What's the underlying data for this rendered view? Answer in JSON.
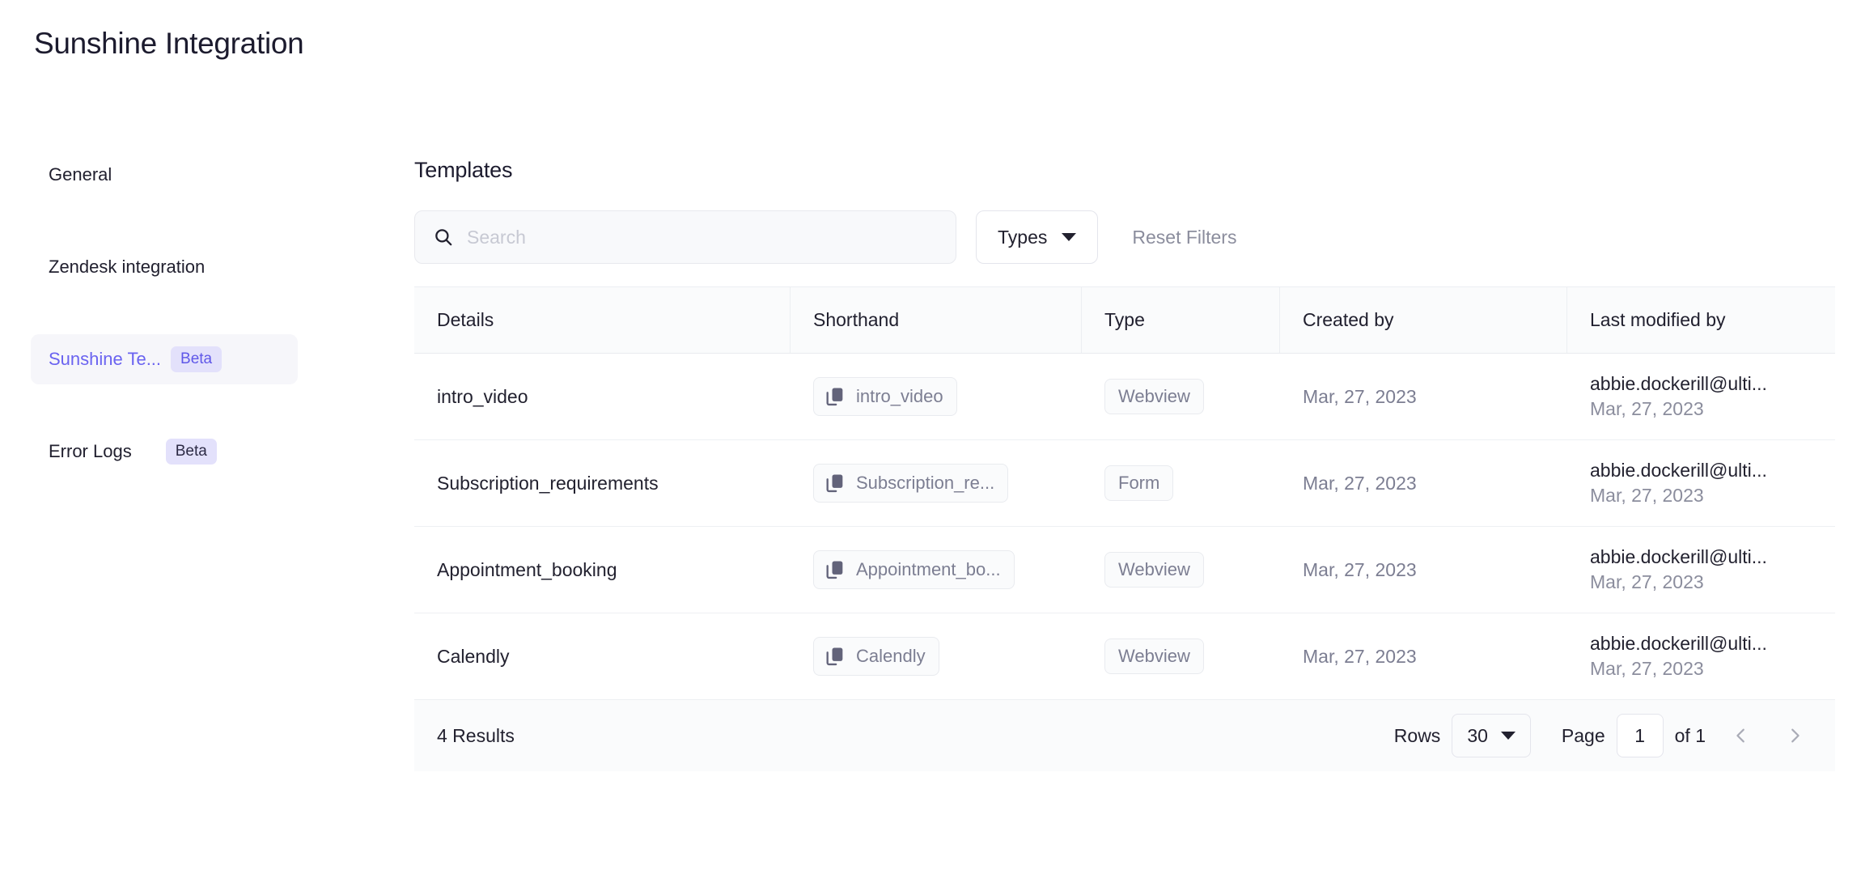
{
  "header": {
    "title": "Sunshine Integration"
  },
  "sidebar": {
    "items": [
      {
        "label": "General",
        "badge": null,
        "active": false
      },
      {
        "label": "Zendesk integration",
        "badge": null,
        "active": false
      },
      {
        "label": "Sunshine Te...",
        "badge": "Beta",
        "active": true
      },
      {
        "label": "Error Logs",
        "badge": "Beta",
        "active": false
      }
    ]
  },
  "main": {
    "section_title": "Templates",
    "filters": {
      "search_placeholder": "Search",
      "search_value": "",
      "search_icon": "search-icon",
      "types_label": "Types",
      "types_caret_icon": "chevron-down-icon",
      "reset_label": "Reset Filters"
    },
    "table": {
      "columns": [
        "Details",
        "Shorthand",
        "Type",
        "Created by",
        "Last modified by"
      ],
      "rows": [
        {
          "details": "intro_video",
          "shorthand": "intro_video",
          "shorthand_icon": "copy-icon",
          "type": "Webview",
          "created_by": "Mar, 27, 2023",
          "modified_email": "abbie.dockerill@ulti...",
          "modified_date": "Mar, 27, 2023"
        },
        {
          "details": "Subscription_requirements",
          "shorthand": "Subscription_re...",
          "shorthand_icon": "copy-icon",
          "type": "Form",
          "created_by": "Mar, 27, 2023",
          "modified_email": "abbie.dockerill@ulti...",
          "modified_date": "Mar, 27, 2023"
        },
        {
          "details": "Appointment_booking",
          "shorthand": "Appointment_bo...",
          "shorthand_icon": "copy-icon",
          "type": "Webview",
          "created_by": "Mar, 27, 2023",
          "modified_email": "abbie.dockerill@ulti...",
          "modified_date": "Mar, 27, 2023"
        },
        {
          "details": "Calendly",
          "shorthand": "Calendly",
          "shorthand_icon": "copy-icon",
          "type": "Webview",
          "created_by": "Mar, 27, 2023",
          "modified_email": "abbie.dockerill@ulti...",
          "modified_date": "Mar, 27, 2023"
        }
      ]
    },
    "footer": {
      "results_label": "4 Results",
      "rows_label": "Rows",
      "rows_value": "30",
      "rows_caret_icon": "chevron-down-icon",
      "page_label": "Page",
      "page_value": "1",
      "of_label": "of 1",
      "prev_icon": "chevron-left-icon",
      "next_icon": "chevron-right-icon"
    }
  },
  "colors": {
    "accent": "#6a63f0",
    "badge_bg": "#e3e1fb",
    "text": "#22212f",
    "muted": "#7c7e92",
    "panel_bg": "#fafbfc"
  }
}
